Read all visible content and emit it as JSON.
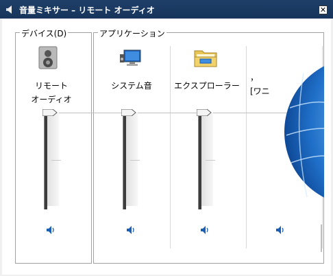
{
  "window": {
    "title": "音量ミキサー – リモート オーディオ",
    "close_glyph": "✕"
  },
  "device_group": {
    "label": "デバイス(D)",
    "device": {
      "name": "リモート\nオーディオ",
      "icon": "speaker-device-icon",
      "volume_level": 1.0
    }
  },
  "app_group": {
    "label": "アプリケーション",
    "apps": [
      {
        "name": "システム音",
        "icon": "system-sounds-icon",
        "volume_level": 1.0
      },
      {
        "name": "エクスプローラー",
        "icon": "explorer-folder-icon",
        "volume_level": 1.0
      },
      {
        "name": "，\n[ワニ",
        "icon": "globe-icon",
        "volume_level": 1.0
      }
    ]
  },
  "colors": {
    "titlebar": "#1f3e67",
    "accent_blue": "#1a5fb4"
  }
}
